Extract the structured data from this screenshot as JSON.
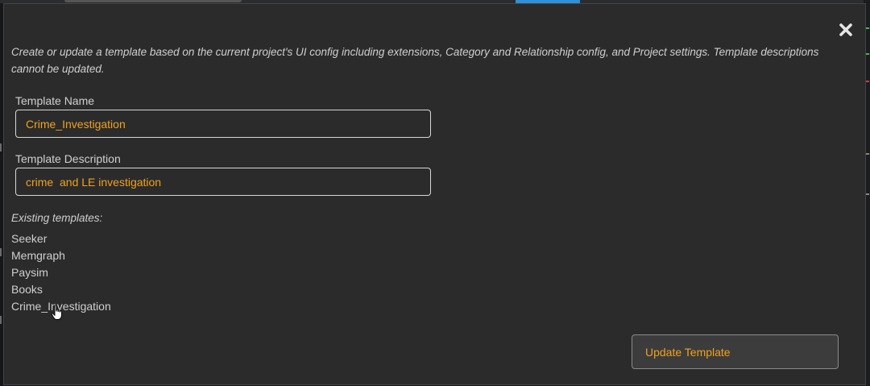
{
  "dialog": {
    "intro_text": "Create or update a template based on the current project's UI config including extensions, Category and Relationship config, and Project settings. Template descriptions cannot be updated.",
    "close_icon": "close-icon"
  },
  "form": {
    "name_label": "Template Name",
    "name_value": "Crime_Investigation",
    "description_label": "Template Description",
    "description_value": "crime  and LE investigation"
  },
  "existing": {
    "heading": "Existing templates:",
    "items": [
      "Seeker",
      "Memgraph",
      "Paysim",
      "Books",
      "Crime_Investigation"
    ]
  },
  "actions": {
    "update_label": "Update Template"
  },
  "colors": {
    "accent": "#f0a21c",
    "dialog_bg": "#2b2b2b",
    "text": "#d0d0d0"
  }
}
